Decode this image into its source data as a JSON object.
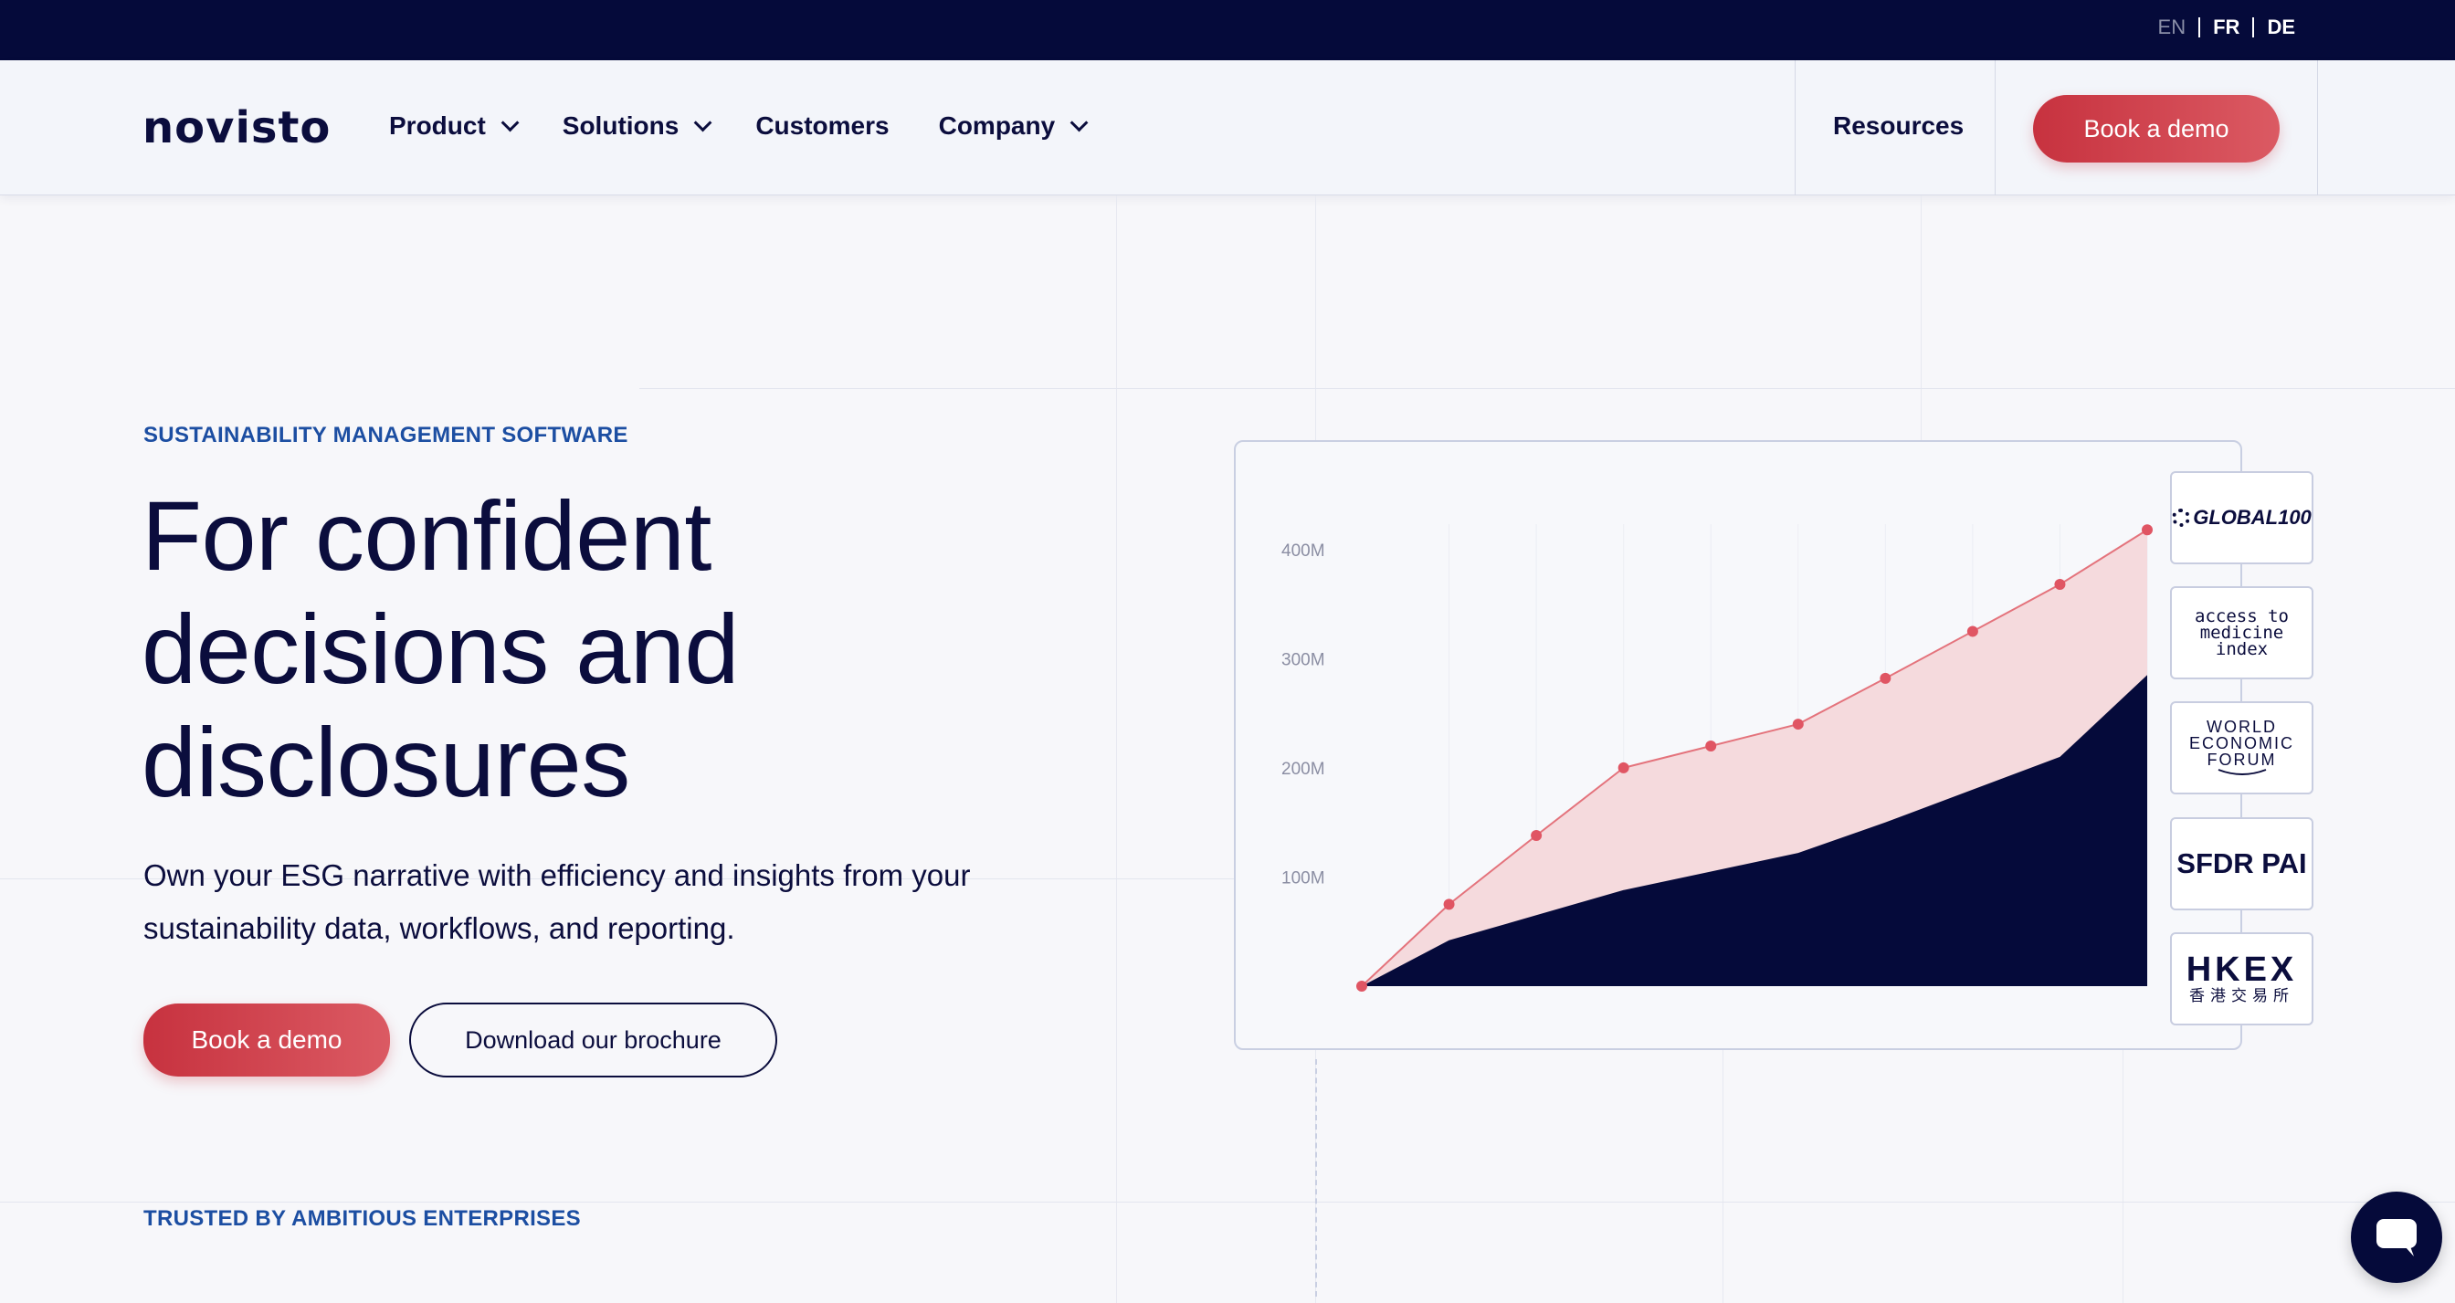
{
  "languages": {
    "en": "EN",
    "fr": "FR",
    "de": "DE"
  },
  "nav": {
    "logo": "novisto",
    "items": [
      {
        "label": "Product",
        "has_dropdown": true
      },
      {
        "label": "Solutions",
        "has_dropdown": true
      },
      {
        "label": "Customers",
        "has_dropdown": false
      },
      {
        "label": "Company",
        "has_dropdown": true
      }
    ],
    "resources": "Resources",
    "cta": "Book a demo"
  },
  "hero": {
    "eyebrow": "SUSTAINABILITY MANAGEMENT SOFTWARE",
    "title_line1": "For confident",
    "title_line2": "decisions and",
    "title_line3": "disclosures",
    "subtitle_line1": "Own your ESG narrative with efficiency and insights from your",
    "subtitle_line2": "sustainability data, workflows, and reporting.",
    "cta_primary": "Book a demo",
    "cta_secondary": "Download our brochure",
    "trusted": "TRUSTED BY AMBITIOUS ENTERPRISES"
  },
  "badges": {
    "global": "GLOBAL100",
    "ami_line1": "access to",
    "ami_line2": "medicine",
    "ami_line3": "index",
    "wef_line1": "WORLD",
    "wef_line2": "ECONOMIC",
    "wef_line3": "FORUM",
    "sfdr": "SFDR PAI",
    "hkex_line1": "HKEX",
    "hkex_line2": "香港交易所"
  },
  "colors": {
    "navy": "#050a3a",
    "accent_red": "#c7323f",
    "eyebrow_blue": "#1c4ea2",
    "area_pink": "#f5dadd"
  },
  "chart_data": {
    "type": "area",
    "y_ticks": [
      "100M",
      "200M",
      "300M",
      "400M"
    ],
    "ylim": [
      0,
      450
    ],
    "grid": true,
    "series": [
      {
        "values": [
          0,
          75,
          138,
          200,
          220,
          240,
          282,
          325,
          368,
          418
        ]
      },
      {
        "values": [
          0,
          42,
          65,
          88,
          105,
          122,
          150,
          180,
          210,
          285
        ]
      }
    ]
  },
  "chat": {
    "icon": "chat-bubble-icon"
  }
}
